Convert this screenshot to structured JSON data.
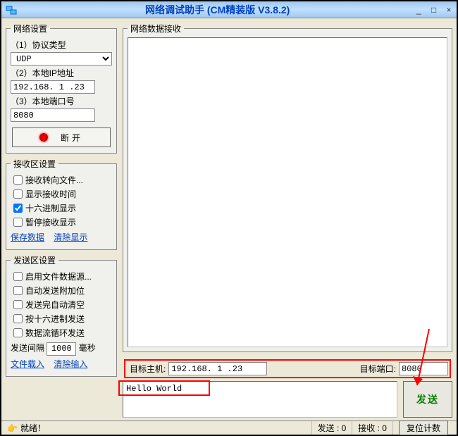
{
  "window": {
    "title": "网络调试助手 (CM精装版 V3.8.2)"
  },
  "net": {
    "legend": "网络设置",
    "proto_label": "（1）协议类型",
    "proto_value": "UDP",
    "ip_label": "（2）本地IP地址",
    "ip_value": "192.168. 1 .23",
    "port_label": "（3）本地端口号",
    "port_value": "8080",
    "disconnect": "断开"
  },
  "recvset": {
    "legend": "接收区设置",
    "opt_file": "接收转向文件...",
    "opt_time": "显示接收时间",
    "opt_hex": "十六进制显示",
    "opt_pause": "暂停接收显示",
    "save": "保存数据",
    "clear": "清除显示"
  },
  "sendset": {
    "legend": "发送区设置",
    "opt_file": "启用文件数据源...",
    "opt_auto_extra": "自动发送附加位",
    "opt_clear_after": "发送完自动清空",
    "opt_hex": "按十六进制发送",
    "opt_loop": "数据流循环发送",
    "interval_label_pre": "发送间隔",
    "interval_value": "1000",
    "interval_label_post": "毫秒",
    "load": "文件载入",
    "clear": "清除输入"
  },
  "recv": {
    "legend": "网络数据接收"
  },
  "dest": {
    "host_label": "目标主机:",
    "host_value": "192.168. 1 .23",
    "port_label": "目标端口:",
    "port_value": "8080"
  },
  "send": {
    "text": "Hello World",
    "button": "发送"
  },
  "status": {
    "ready_icon": "👉",
    "ready": "就绪！",
    "sent_label": "发送 : 0",
    "recv_label": "接收 : 0",
    "reset": "复位计数"
  }
}
